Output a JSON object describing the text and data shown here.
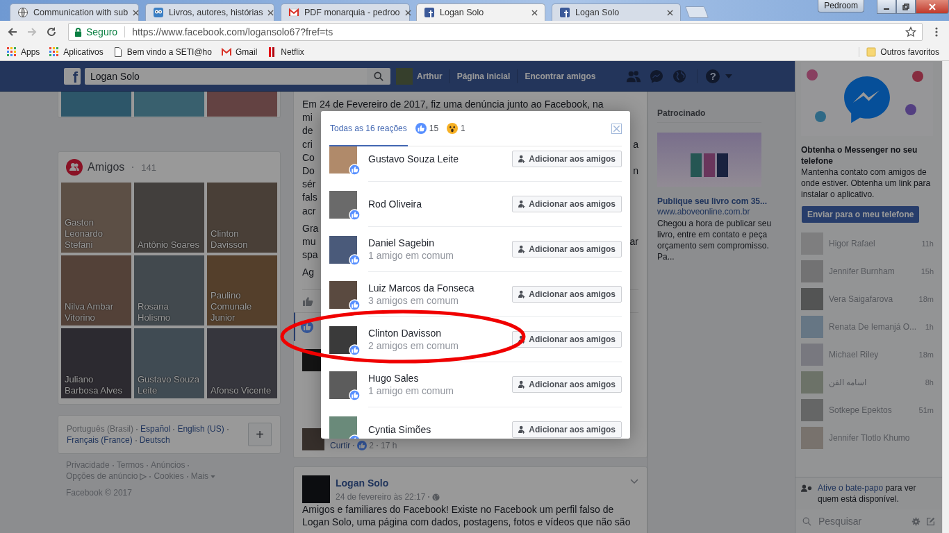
{
  "browser": {
    "tabs": [
      {
        "title": "Communication with sub",
        "kind": "wiki",
        "selected": false
      },
      {
        "title": "Livros, autores, histórias",
        "kind": "owl",
        "selected": false
      },
      {
        "title": "PDF monarquia - pedroo",
        "kind": "gmail",
        "selected": false
      },
      {
        "title": "Logan Solo",
        "kind": "facebook",
        "selected": true
      },
      {
        "title": "Logan Solo",
        "kind": "facebook",
        "selected": false
      }
    ],
    "profile": "Pedroom",
    "security": "Seguro",
    "url": "https://www.facebook.com/logansolo67?fref=ts",
    "bookmarks": [
      {
        "label": "Apps",
        "kind": "apps"
      },
      {
        "label": "Aplicativos",
        "kind": "apps"
      },
      {
        "label": "Bem vindo a SETI@ho",
        "kind": "page"
      },
      {
        "label": "Gmail",
        "kind": "gmail"
      },
      {
        "label": "Netflix",
        "kind": "netflix"
      }
    ],
    "other_bookmarks": "Outros favoritos"
  },
  "header": {
    "logo": "f",
    "search_value": "Logan Solo",
    "user": "Arthur",
    "nav": [
      "Página inicial",
      "Encontrar amigos"
    ],
    "help": "?"
  },
  "friends_card": {
    "title": "Amigos",
    "count": "141",
    "friends": [
      "Gaston Leonardo Stefani",
      "Antônio Soares",
      "Clinton Davisson",
      "Nilva Ambar Vitorino",
      "Rosana Holismo",
      "Paulino Comunale Junior",
      "Juliano Barbosa Alves",
      "Gustavo Souza Leite",
      "Afonso Vicente"
    ]
  },
  "languages": {
    "items": [
      {
        "label": "Português (Brasil)",
        "selected": true
      },
      {
        "label": "Español",
        "selected": false
      },
      {
        "label": "English (US)",
        "selected": false
      },
      {
        "label": "Français (France)",
        "selected": false
      },
      {
        "label": "Deutsch",
        "selected": false
      }
    ],
    "add": "+"
  },
  "footer": {
    "links": [
      "Privacidade",
      "Termos",
      "Anúncios",
      "Opções de anúncio",
      "Cookies",
      "Mais"
    ],
    "copyright": "Facebook © 2017"
  },
  "post": {
    "paragraphs": [
      [
        {
          "left": "Em 24 de Fevereiro de 2017, fiz uma denúncia junto ao Facebook, na"
        },
        {
          "left": "mi"
        },
        {
          "left": "de"
        },
        {
          "left": "cri",
          "right": "a"
        },
        {
          "left": "Co"
        },
        {
          "left": "Do",
          "right": "n"
        },
        {
          "left": "sér"
        },
        {
          "left": "fals"
        },
        {
          "left": "acr"
        }
      ],
      [
        {
          "left": "Gra"
        },
        {
          "left": "mu",
          "right": "ar"
        },
        {
          "left": "spa"
        }
      ],
      [
        {
          "left": "Ag"
        }
      ]
    ],
    "comment": {
      "like_label": "Curtir",
      "count": "2",
      "time": "17 h"
    }
  },
  "post2": {
    "author": "Logan Solo",
    "date": "24 de fevereiro às 22:17",
    "lines": [
      "Amigos e familiares do Facebook! Existe no Facebook um perfil falso de",
      "Logan Solo, uma página com dados, postagens, fotos e vídeos que não são"
    ]
  },
  "sponsored": {
    "heading": "Patrocinado",
    "title": "Publique seu livro com 35...",
    "url": "www.aboveonline.com.br",
    "body": "Chegou a hora de publicar seu livro, entre em contato e peça orçamento sem compromisso. Pa..."
  },
  "chat": {
    "promo_title": "Obtenha o Messenger no seu telefone",
    "promo_text": "Mantenha contato com amigos de onde estiver. Obtenha um link para instalar o aplicativo.",
    "promo_button": "Enviar para o meu telefone",
    "contacts": [
      {
        "name": "Higor Rafael",
        "time": "11h"
      },
      {
        "name": "Jennifer Burnham",
        "time": "15h"
      },
      {
        "name": "Vera Saigafarova",
        "time": "18m"
      },
      {
        "name": "Renata De Iemanjá O...",
        "time": "1h"
      },
      {
        "name": "Michael Riley",
        "time": "18m"
      },
      {
        "name": "اسامه الفن",
        "time": "8h"
      },
      {
        "name": "Sotkepe Epektos",
        "time": "51m"
      },
      {
        "name": "Jennifer Tlotlo Khumo"
      }
    ],
    "activate_link": "Ative o bate-papo",
    "activate_rest": " para ver quem está disponível.",
    "search_placeholder": "Pesquisar"
  },
  "reactions_dialog": {
    "tabs": [
      {
        "kind": "all",
        "label": "Todas as 16 reações",
        "selected": true
      },
      {
        "kind": "like",
        "label": "15",
        "selected": false
      },
      {
        "kind": "wow",
        "label": "1",
        "selected": false
      }
    ],
    "people": [
      {
        "name": "Gustavo Souza Leite",
        "button": "Adicionar aos amigos"
      },
      {
        "name": "Rod Oliveira",
        "button": "Adicionar aos amigos"
      },
      {
        "name": "Daniel Sagebin",
        "mutual": "1 amigo em comum",
        "button": "Adicionar aos amigos"
      },
      {
        "name": "Luiz Marcos da Fonseca",
        "mutual": "3 amigos em comum",
        "button": "Adicionar aos amigos"
      },
      {
        "name": "Clinton Davisson",
        "mutual": "2 amigos em comum",
        "button": "Adicionar aos amigos"
      },
      {
        "name": "Hugo Sales",
        "mutual": "1 amigo em comum",
        "button": "Adicionar aos amigos"
      },
      {
        "name": "Cyntia Simões",
        "button": "Adicionar aos amigos"
      }
    ]
  }
}
